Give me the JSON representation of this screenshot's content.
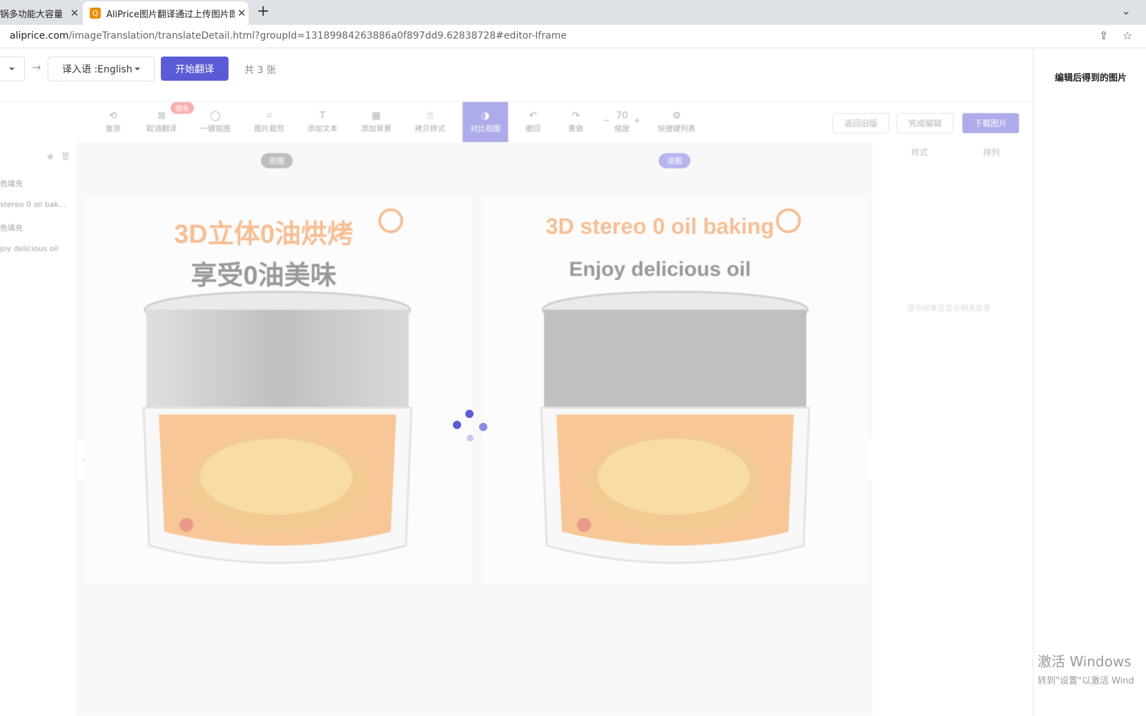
{
  "browser": {
    "tabs": [
      {
        "label": "锅多功能大容量",
        "active": false
      },
      {
        "label": "AliPrice图片翻译通过上传图片即",
        "active": true
      }
    ],
    "url_domain": "aliprice.com",
    "url_path": "/imageTranslation/translateDetail.html?groupId=13189984263886a0f897dd9.62838728#editor-Iframe"
  },
  "header": {
    "target_language": "译入语 :English",
    "start_button": "开始翻译",
    "count_text": "共 3 张"
  },
  "right_column": {
    "title": "编辑后得到的图片",
    "watermark_line1": "激活 Windows",
    "watermark_line2": "转到\"设置\"以激活 Wind"
  },
  "toolbar": {
    "tools": [
      {
        "label": "复原",
        "icon": "undo-icon"
      },
      {
        "label": "取消翻译",
        "icon": "cancel-translate-icon"
      },
      {
        "label": "一键抠图",
        "icon": "cutout-icon"
      },
      {
        "label": "图片裁剪",
        "icon": "crop-icon"
      },
      {
        "label": "添加文本",
        "icon": "text-icon"
      },
      {
        "label": "添加背景",
        "icon": "background-icon"
      },
      {
        "label": "拷贝样式",
        "icon": "format-painter-icon"
      },
      {
        "label": "对比视图",
        "icon": "compare-icon",
        "active": true
      },
      {
        "label": "撤回",
        "icon": "back-icon"
      },
      {
        "label": "重做",
        "icon": "redo-icon"
      },
      {
        "label": "缩放",
        "icon": "zoom-icon"
      },
      {
        "label": "快捷键列表",
        "icon": "settings-icon"
      }
    ],
    "badge": "限免",
    "zoom_value": "70",
    "buttons": {
      "old_version": "返回旧版",
      "finish": "完成编辑",
      "download": "下载图片"
    }
  },
  "layers": [
    "色填充",
    "stereo 0 oil bak...",
    "色填充",
    "joy delicious oil"
  ],
  "side_panel": {
    "tab_style": "样式",
    "tab_arrange": "排列",
    "empty_text": "选中对象后显示相关信息"
  },
  "canvas": {
    "original_pill": "原图",
    "translated_pill": "译图",
    "original": {
      "line1": "3D立体0油烘烤",
      "line2": "享受0油美味"
    },
    "translated": {
      "line1": "3D stereo 0 oil baking",
      "line2": "Enjoy delicious oil"
    }
  },
  "colors": {
    "accent": "#5b5bd6",
    "orange": "#ef8a3e",
    "badge": "#f56c6c"
  }
}
